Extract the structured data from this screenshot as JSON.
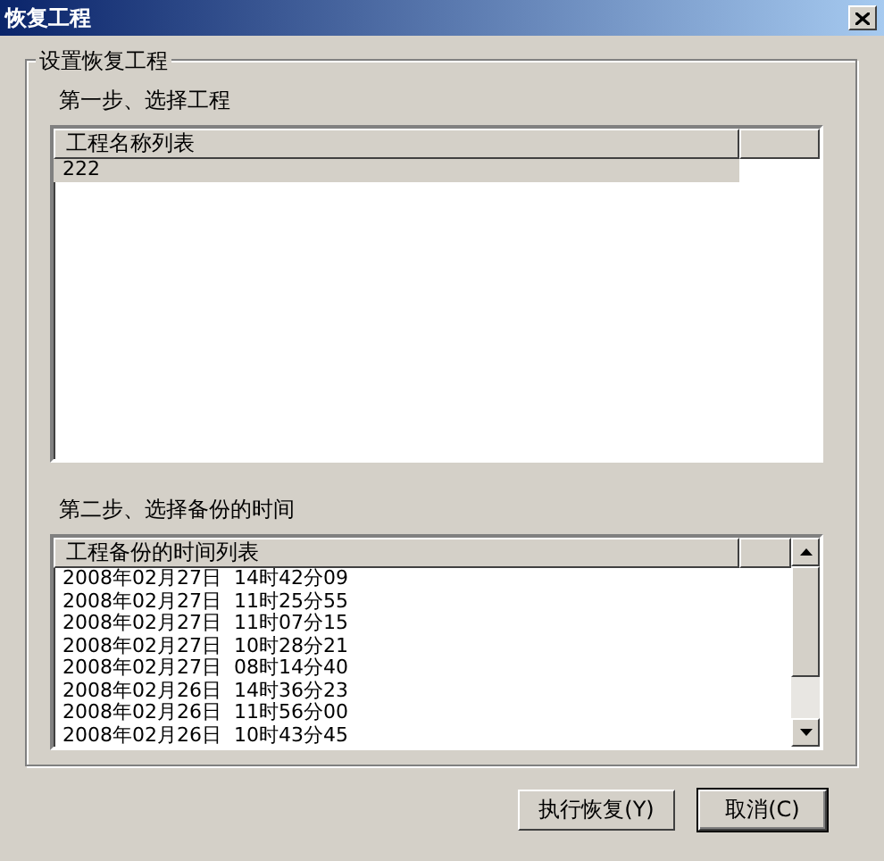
{
  "window": {
    "title": "恢复工程"
  },
  "group": {
    "title": "设置恢复工程"
  },
  "step1": {
    "label": "第一步、选择工程",
    "list": {
      "columns": [
        "工程名称列表"
      ],
      "rows": [
        {
          "text": "222",
          "selected": true
        }
      ]
    }
  },
  "step2": {
    "label": "第二步、选择备份的时间",
    "list": {
      "columns": [
        "工程备份的时间列表"
      ],
      "rows": [
        {
          "text": "2008年02月27日  14时42分09",
          "selected": false
        },
        {
          "text": "2008年02月27日  11时25分55",
          "selected": false
        },
        {
          "text": "2008年02月27日  11时07分15",
          "selected": false
        },
        {
          "text": "2008年02月27日  10时28分21",
          "selected": false
        },
        {
          "text": "2008年02月27日  08时14分40",
          "selected": false
        },
        {
          "text": "2008年02月26日  14时36分23",
          "selected": false
        },
        {
          "text": "2008年02月26日  11时56分00",
          "selected": false
        },
        {
          "text": "2008年02月26日  10时43分45",
          "selected": false
        }
      ]
    }
  },
  "buttons": [
    {
      "label": "执行恢复(Y)",
      "default": false
    },
    {
      "label": "取消(C)",
      "default": true
    }
  ]
}
